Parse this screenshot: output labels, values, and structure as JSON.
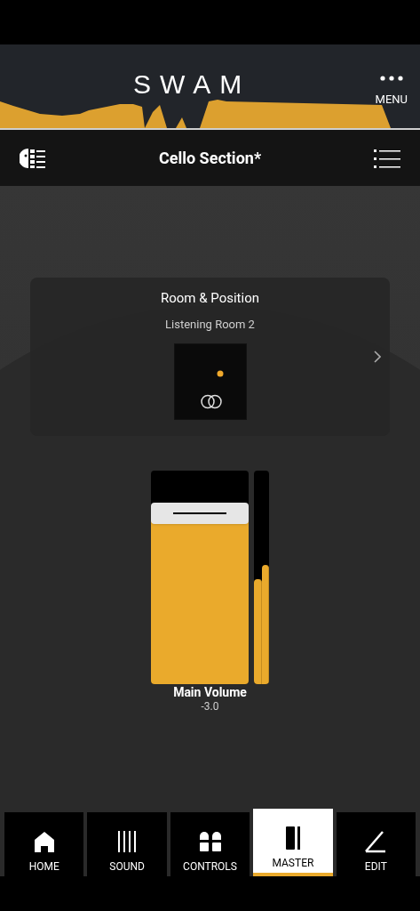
{
  "header": {
    "logo": "SWAM",
    "menu_label": "MENU"
  },
  "title_bar": {
    "title": "Cello Section*"
  },
  "room_card": {
    "title": "Room & Position",
    "room": "Listening Room 2"
  },
  "fader": {
    "label": "Main Volume",
    "reading": "-3.0",
    "level": 0.8
  },
  "meters": [
    {
      "level": 0.49
    },
    {
      "level": 0.56
    }
  ],
  "nav": [
    {
      "label": "HOME",
      "kind": "home",
      "selected": false
    },
    {
      "label": "SOUND",
      "kind": "sound",
      "selected": false
    },
    {
      "label": "CONTROLS",
      "kind": "controls",
      "selected": false
    },
    {
      "label": "MASTER",
      "kind": "master",
      "selected": true
    },
    {
      "label": "EDIT",
      "kind": "edit",
      "selected": false
    }
  ]
}
